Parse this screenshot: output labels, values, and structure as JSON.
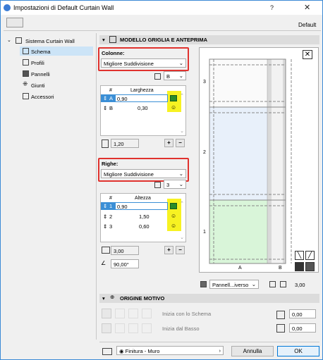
{
  "window": {
    "title": "Impostazioni di Default Curtain Wall",
    "help": "?",
    "close": "✕",
    "default_label": "Default"
  },
  "sidebar": {
    "root": "Sistema Curtain Wall",
    "items": [
      {
        "label": "Schema"
      },
      {
        "label": "Profili"
      },
      {
        "label": "Pannelli"
      },
      {
        "label": "Giunti"
      },
      {
        "label": "Accessori"
      }
    ]
  },
  "section_grid": {
    "title": "MODELLO GRIGLIA E ANTEPRIMA"
  },
  "columns": {
    "label": "Colonne:",
    "mode": "Migliore Suddivisione",
    "count": "B",
    "header_num": "#",
    "header_size": "Larghezza",
    "rows": [
      {
        "idx": "A",
        "value": "0,90"
      },
      {
        "idx": "B",
        "value": "0,30"
      }
    ],
    "total": "1,20"
  },
  "rows_group": {
    "label": "Righe:",
    "mode": "Migliore Suddivisione",
    "count": "3",
    "header_num": "#",
    "header_size": "Altezza",
    "rows": [
      {
        "idx": "1",
        "value": "0,90"
      },
      {
        "idx": "2",
        "value": "1,50"
      },
      {
        "idx": "3",
        "value": "0,60"
      }
    ],
    "total": "3,00",
    "angle": "90,00°"
  },
  "preview": {
    "col_labels": [
      "A",
      "B"
    ],
    "row_labels": [
      "3",
      "2",
      "1"
    ],
    "panel_select": "Pannell...iverso",
    "dim_value": "3,00"
  },
  "section_origin": {
    "title": "ORIGINE MOTIVO",
    "start_label": "Inizia con lo Schema",
    "bottom_label": "Inizia dal Basso",
    "x_value": "0,00",
    "y_value": "0,00"
  },
  "footer": {
    "finish": "Finitura - Muro",
    "cancel": "Annulla",
    "ok": "OK"
  }
}
